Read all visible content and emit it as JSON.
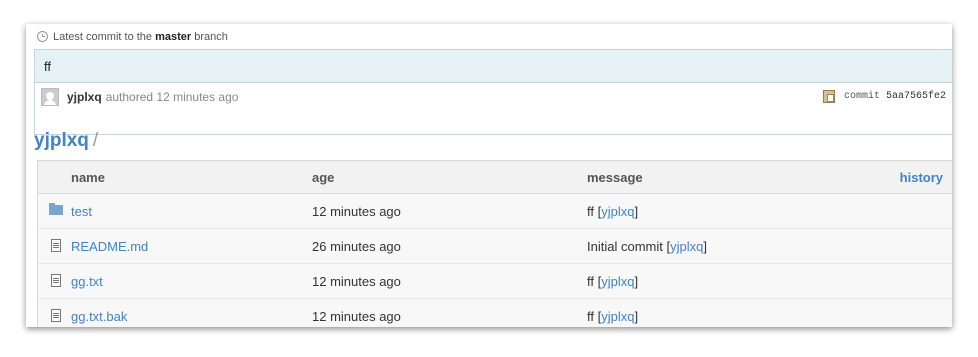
{
  "latest_commit": {
    "prefix": "Latest commit to the",
    "branch": "master",
    "suffix": "branch",
    "message": "ff",
    "author": "yjplxq",
    "authored_text": "authored 12 minutes ago",
    "commit_label": "commit",
    "sha": "5aa7565fe2"
  },
  "breadcrumb": {
    "repo": "yjplxq",
    "separator": "/"
  },
  "table": {
    "headers": {
      "name": "name",
      "age": "age",
      "message": "message",
      "history": "history"
    },
    "rows": [
      {
        "icon": "folder-icon",
        "name": "test",
        "age": "12 minutes ago",
        "message": "ff",
        "author": "yjplxq"
      },
      {
        "icon": "file-icon",
        "name": "README.md",
        "age": "26 minutes ago",
        "message": "Initial commit",
        "author": "yjplxq"
      },
      {
        "icon": "file-icon",
        "name": "gg.txt",
        "age": "12 minutes ago",
        "message": "ff",
        "author": "yjplxq"
      },
      {
        "icon": "file-icon",
        "name": "gg.txt.bak",
        "age": "12 minutes ago",
        "message": "ff",
        "author": "yjplxq"
      }
    ]
  }
}
